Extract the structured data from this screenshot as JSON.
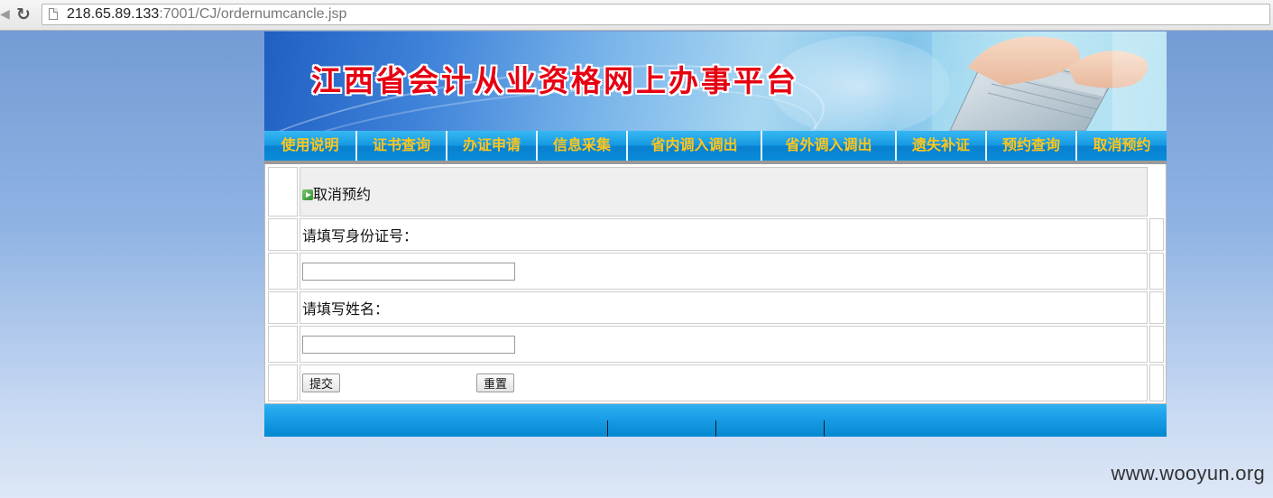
{
  "browser": {
    "url_host": "218.65.89.133",
    "url_rest": ":7001/CJ/ordernumcancle.jsp"
  },
  "banner": {
    "title": "江西省会计从业资格网上办事平台"
  },
  "nav": {
    "items": [
      {
        "label": "使用说明"
      },
      {
        "label": "证书查询"
      },
      {
        "label": "办证申请"
      },
      {
        "label": "信息采集"
      },
      {
        "label": "省内调入调出"
      },
      {
        "label": "省外调入调出"
      },
      {
        "label": "遗失补证"
      },
      {
        "label": "预约查询"
      },
      {
        "label": "取消预约"
      }
    ]
  },
  "form": {
    "title": "取消预约",
    "id_label": "请填写身份证号：",
    "id_value": "",
    "name_label": "请填写姓名：",
    "name_value": "",
    "submit_label": "提交",
    "reset_label": "重置"
  },
  "watermark": "www.wooyun.org",
  "colors": {
    "nav_text": "#ffc61a",
    "banner_title": "#e60012",
    "nav_bg": "#1597e0"
  }
}
